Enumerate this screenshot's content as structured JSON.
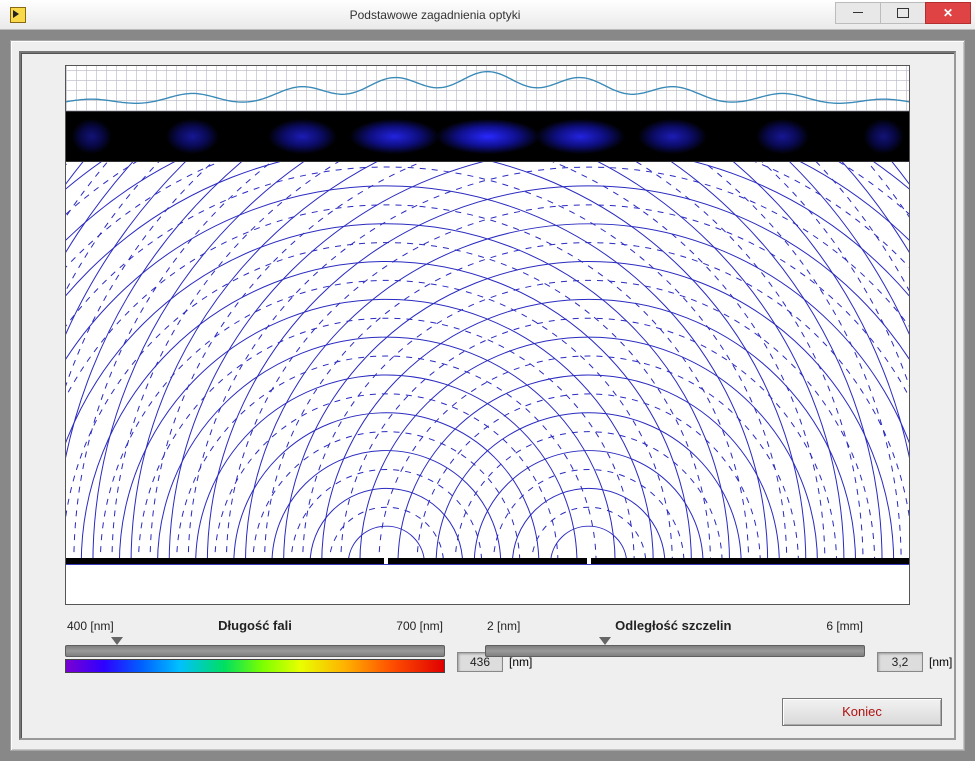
{
  "window": {
    "title": "Podstawowe zagadnienia optyki"
  },
  "wavelength": {
    "label": "Długość fali",
    "min_label": "400 [nm]",
    "max_label": "700 [nm]",
    "value": "436",
    "unit": "[nm]",
    "fraction": 0.12
  },
  "slit_distance": {
    "label": "Odległość szczelin",
    "min_label": "2 [nm]",
    "max_label": "6 [mm]",
    "value": "3,2",
    "unit": "[nm]",
    "fraction": 0.3
  },
  "buttons": {
    "close": "Koniec"
  },
  "chart_data": {
    "type": "other",
    "description": "Double-slit interference simulation",
    "wavelength_nm": 436,
    "slit_separation_mm": 3.2,
    "fringe_centers_percent": [
      3,
      15,
      28,
      39,
      50,
      61,
      72,
      85,
      97
    ],
    "fringe_relative_intensity": [
      0.18,
      0.35,
      0.55,
      0.82,
      1.0,
      0.82,
      0.55,
      0.35,
      0.18
    ],
    "slit_positions_percent": [
      38,
      62
    ],
    "num_wavefronts_per_slit_solid": 11,
    "num_wavefronts_per_slit_dashed": 11
  }
}
